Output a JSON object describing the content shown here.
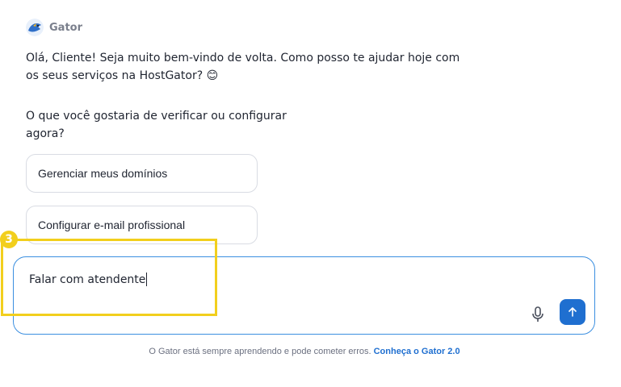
{
  "assistant": {
    "name": "Gator",
    "avatar_icon": "gator-avatar-icon"
  },
  "messages": {
    "greeting": "Olá, Cliente! Seja muito bem-vindo de volta. Como posso te ajudar hoje com os seus serviços na HostGator? 😊",
    "question": "O que você gostaria de verificar ou configurar agora?"
  },
  "options": [
    {
      "label": "Gerenciar meus domínios"
    },
    {
      "label": "Configurar e-mail profissional"
    }
  ],
  "composer": {
    "value": "Falar com atendente",
    "mic_icon": "microphone-icon",
    "send_icon": "arrow-up-icon"
  },
  "footer": {
    "disclaimer": "O Gator está sempre aprendendo e pode cometer erros.",
    "link_label": "Conheça o Gator 2.0"
  },
  "annotation": {
    "number": "3",
    "color": "#f2cf1d"
  },
  "colors": {
    "accent": "#1f6fd0",
    "border_active": "#3b8fe0"
  }
}
